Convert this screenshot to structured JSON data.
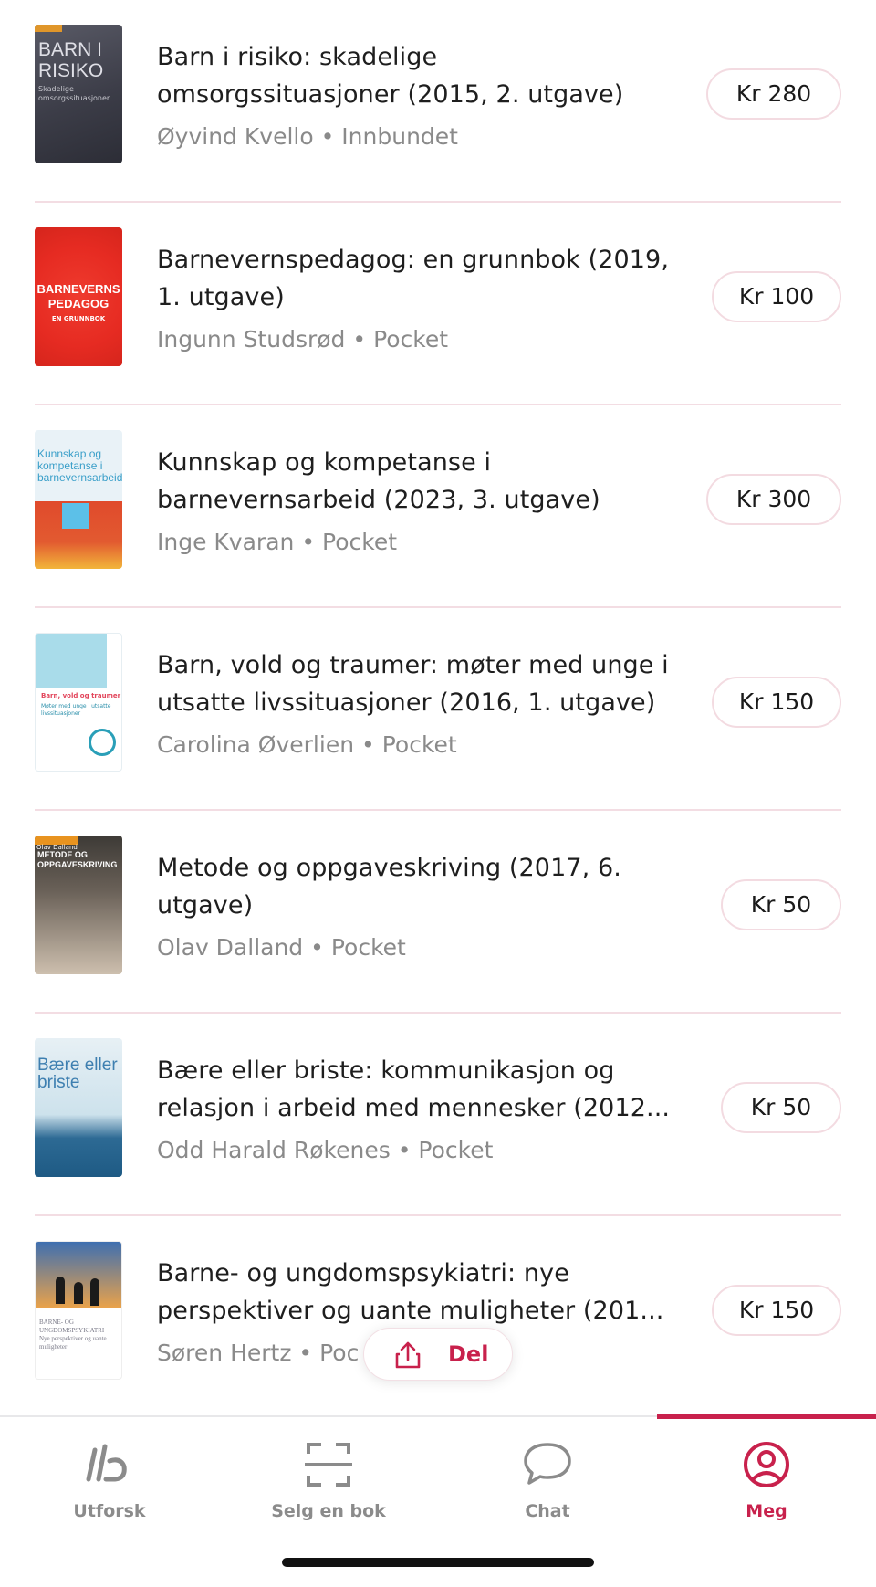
{
  "books": [
    {
      "title": "Barn i risiko: skadelige omsorgssituasjoner (2015, 2. utgave)",
      "author": "Øyvind Kvello",
      "format": "Innbundet",
      "price": "Kr 280",
      "cover_title": "BARN I RISIKO",
      "cover_subtitle": "Skadelige omsorgssituasjoner"
    },
    {
      "title": "Barnevernspedagog: en grunnbok (2019, 1. utgave)",
      "author": "Ingunn Studsrød",
      "format": "Pocket",
      "price": "Kr 100",
      "cover_title": "BARNEVERNS PEDAGOG",
      "cover_subtitle": "EN GRUNNBOK"
    },
    {
      "title": "Kunnskap og kompetanse i barnevernsarbeid (2023, 3. utgave)",
      "author": "Inge Kvaran",
      "format": "Pocket",
      "price": "Kr 300",
      "cover_title": "Kunnskap og kompetanse i barnevernsarbeid"
    },
    {
      "title": "Barn, vold og traumer: møter med unge i utsatte livssituasjoner (2016, 1. utgave)",
      "author": "Carolina Øverlien",
      "format": "Pocket",
      "price": "Kr 150",
      "cover_title": "Barn, vold og traumer",
      "cover_subtitle": "Møter med unge i utsatte livssituasjoner"
    },
    {
      "title": "Metode og oppgaveskriving (2017, 6. utgave)",
      "author": "Olav Dalland",
      "format": "Pocket",
      "price": "Kr 50",
      "cover_band": "Olav Dalland",
      "cover_title": "METODE OG OPPGAVESKRIVING"
    },
    {
      "title": "Bære eller briste: kommunikasjon og relasjon i arbeid med mennesker (2012...",
      "author": "Odd Harald Røkenes",
      "format": "Pocket",
      "price": "Kr 50",
      "cover_title": "Bære eller briste"
    },
    {
      "title": "Barne- og ungdomspsykiatri: nye perspektiver og uante muligheter (201...",
      "author": "Søren Hertz",
      "format": "Poc",
      "price": "Kr 150",
      "cover_title": "BARNE- OG UNGDOMSPSYKIATRI",
      "cover_subtitle": "Nye perspektiver og uante muligheter"
    }
  ],
  "meta_separator": "•",
  "share": {
    "label": "Del"
  },
  "tabs": [
    {
      "label": "Utforsk",
      "icon": "ub-logo-icon"
    },
    {
      "label": "Selg en bok",
      "icon": "scan-icon"
    },
    {
      "label": "Chat",
      "icon": "chat-bubble-icon"
    },
    {
      "label": "Meg",
      "icon": "profile-icon",
      "active": true
    }
  ],
  "colors": {
    "accent": "#c8214c",
    "divider": "#f3dde3",
    "muted": "#8a8a8a"
  }
}
